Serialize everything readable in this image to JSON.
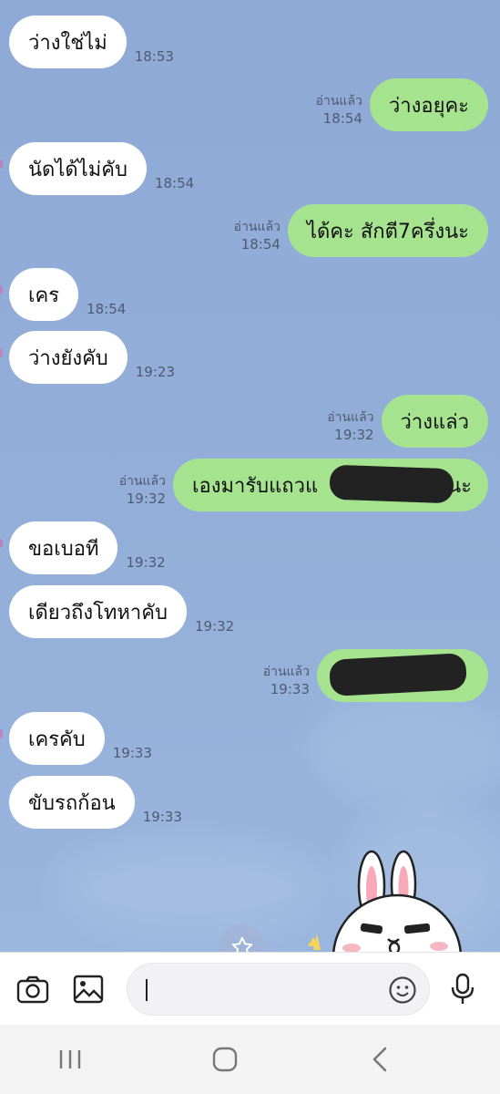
{
  "colors": {
    "chat_bg": "#8fa9d6",
    "incoming_bubble": "#ffffff",
    "outgoing_bubble": "#a6e38e",
    "meta_text": "#4e5a6e"
  },
  "messages": [
    {
      "dir": "in",
      "text": "ว่างใช่ไม่",
      "time": "18:53"
    },
    {
      "dir": "out",
      "text": "ว่างอยุคะ",
      "time": "18:54",
      "read": "อ่านแล้ว"
    },
    {
      "dir": "in",
      "text": "นัดได้ไม่คับ",
      "time": "18:54"
    },
    {
      "dir": "out",
      "text": "ได้คะ สักตี7ครึ่งนะ",
      "time": "18:54",
      "read": "อ่านแล้ว"
    },
    {
      "dir": "in",
      "text": "เคร",
      "time": "18:54"
    },
    {
      "dir": "in",
      "text": "ว่างยังคับ",
      "time": "19:23"
    },
    {
      "dir": "out",
      "text": "ว่างแล่ว",
      "time": "19:32",
      "read": "อ่านแล้ว"
    },
    {
      "dir": "out",
      "text": "เองมารับแถวแ",
      "text_end": "นะ",
      "time": "19:32",
      "read": "อ่านแล้ว"
    },
    {
      "dir": "in",
      "text": "ขอเบอที",
      "time": "19:32"
    },
    {
      "dir": "in",
      "text": "เดียวถึงโทหาคับ",
      "time": "19:32"
    },
    {
      "dir": "out",
      "text": "",
      "time": "19:33",
      "read": "อ่านแล้ว"
    },
    {
      "dir": "in",
      "text": "เครคับ",
      "time": "19:33"
    },
    {
      "dir": "in",
      "text": "ขับรถก้อน",
      "time": "19:33"
    }
  ],
  "input": {
    "placeholder": ""
  },
  "icons": [
    "camera-icon",
    "image-icon",
    "emoji-icon",
    "microphone-icon",
    "star-icon",
    "sticker-bunny",
    "recents-icon",
    "home-icon",
    "back-icon"
  ]
}
